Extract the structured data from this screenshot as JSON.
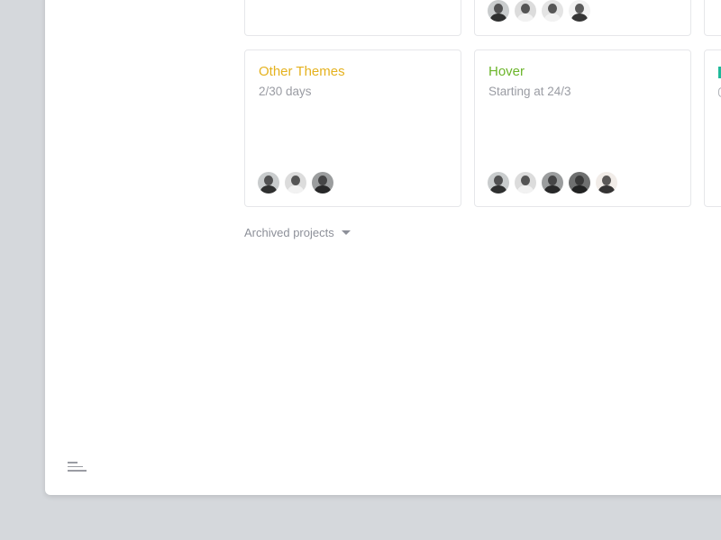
{
  "colors": {
    "background": "#d5d8dc",
    "yellow": "#e5b21f",
    "green": "#6cb52b",
    "teal": "#1fb99a"
  },
  "top_row": [
    {
      "avatars": []
    },
    {
      "avatars": [
        "avatar",
        "avatar",
        "avatar",
        "avatar"
      ]
    }
  ],
  "projects": [
    {
      "title": "Other Themes",
      "subtitle": "2/30 days",
      "color": "#e5b21f",
      "avatars": [
        "avatar",
        "avatar",
        "avatar"
      ]
    },
    {
      "title": "Hover",
      "subtitle": "Starting at 24/3",
      "color": "#6cb52b",
      "avatars": [
        "avatar",
        "avatar",
        "avatar",
        "avatar",
        "avatar"
      ]
    }
  ],
  "archived": {
    "label": "Archived projects",
    "icon": "caret-down-icon"
  },
  "footer": {
    "icon": "menu-icon"
  }
}
